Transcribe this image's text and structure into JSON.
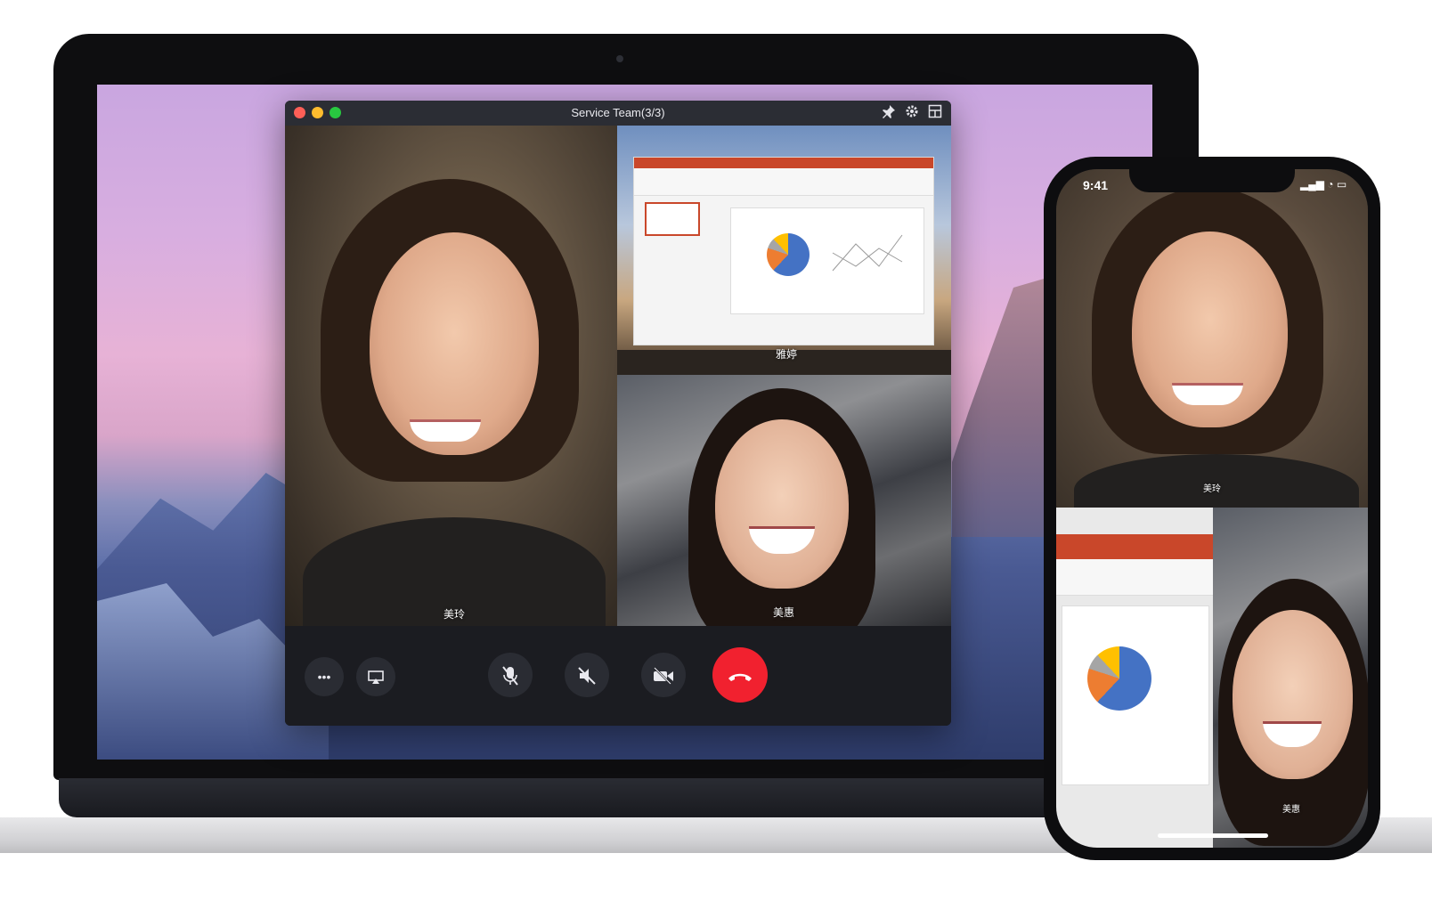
{
  "window": {
    "title": "Service Team(3/3)",
    "traffic_lights": [
      "#fe5f57",
      "#febc2e",
      "#28c840"
    ],
    "toolbar_icons": [
      "pin-icon",
      "gear-icon",
      "layout-icon"
    ]
  },
  "participants": {
    "main": {
      "name": "美玲"
    },
    "screen_share": {
      "name": "雅婷"
    },
    "bottom_right": {
      "name": "美惠"
    }
  },
  "controls": {
    "more": "•••",
    "buttons": [
      "more-icon",
      "screen-share-icon",
      "mic-off-icon",
      "speaker-off-icon",
      "camera-off-icon",
      "end-call-icon"
    ],
    "end_call_color": "#f1212f"
  },
  "phone": {
    "time": "9:41",
    "status": "▂▄▆ ◔ ▭",
    "participants": {
      "top": "美玲",
      "bottom_right": "美惠"
    }
  }
}
